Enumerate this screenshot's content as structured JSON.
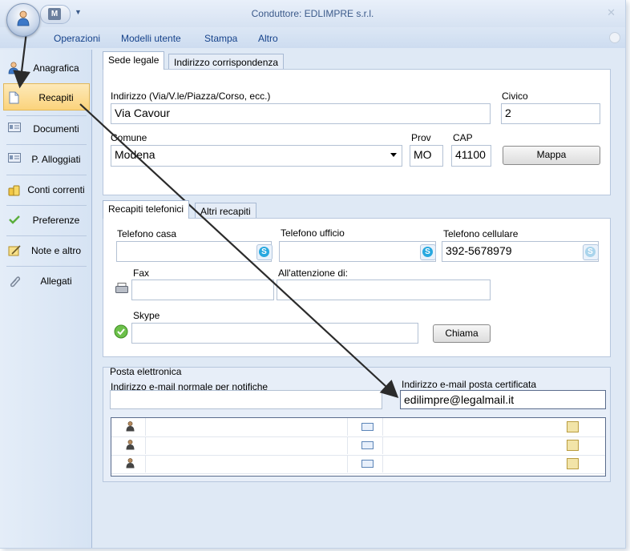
{
  "window": {
    "title": "Conduttore: EDLIMPRE s.r.l."
  },
  "ribbon": {
    "menu": [
      "Operazioni",
      "Modelli utente",
      "Stampa",
      "Altro"
    ]
  },
  "sidebar": {
    "items": [
      {
        "label": "Anagrafica",
        "icon": "person-icon"
      },
      {
        "label": "Recapiti",
        "icon": "document-icon",
        "active": true
      },
      {
        "label": "Documenti",
        "icon": "id-card-icon"
      },
      {
        "label": "P. Alloggiati",
        "icon": "id-card-icon"
      },
      {
        "label": "Conti correnti",
        "icon": "coins-icon"
      },
      {
        "label": "Preferenze",
        "icon": "checkmark-icon"
      },
      {
        "label": "Note e altro",
        "icon": "notes-icon"
      },
      {
        "label": "Allegati",
        "icon": "paperclip-icon"
      }
    ]
  },
  "address": {
    "tabs": [
      "Sede legale",
      "Indirizzo corrispondenza"
    ],
    "indirizzo_label": "Indirizzo (Via/V.le/Piazza/Corso, ecc.)",
    "indirizzo_value": "Via Cavour",
    "civico_label": "Civico",
    "civico_value": "2",
    "comune_label": "Comune",
    "comune_value": "Modena",
    "prov_label": "Prov",
    "prov_value": "MO",
    "cap_label": "CAP",
    "cap_value": "41100",
    "mappa_button": "Mappa"
  },
  "contacts": {
    "tabs": [
      "Recapiti telefonici",
      "Altri recapiti"
    ],
    "telefono_casa_label": "Telefono casa",
    "telefono_casa_value": "",
    "telefono_ufficio_label": "Telefono ufficio",
    "telefono_ufficio_value": "",
    "telefono_cellulare_label": "Telefono cellulare",
    "telefono_cellulare_value": "392-5678979",
    "fax_label": "Fax",
    "fax_value": "",
    "attenzione_label": "All'attenzione di:",
    "attenzione_value": "",
    "skype_label": "Skype",
    "skype_value": "",
    "chiama_button": "Chiama"
  },
  "email": {
    "group_title": "Posta elettronica",
    "normale_label": "Indirizzo e-mail normale per notifiche",
    "normale_value": "",
    "certificata_label": "Indirizzo e-mail posta certificata",
    "certificata_value": "edilimpre@legalmail.it"
  },
  "colors": {
    "accent": "#15428b",
    "active_nav": "#fbd37b",
    "skype": "#28a8df"
  }
}
